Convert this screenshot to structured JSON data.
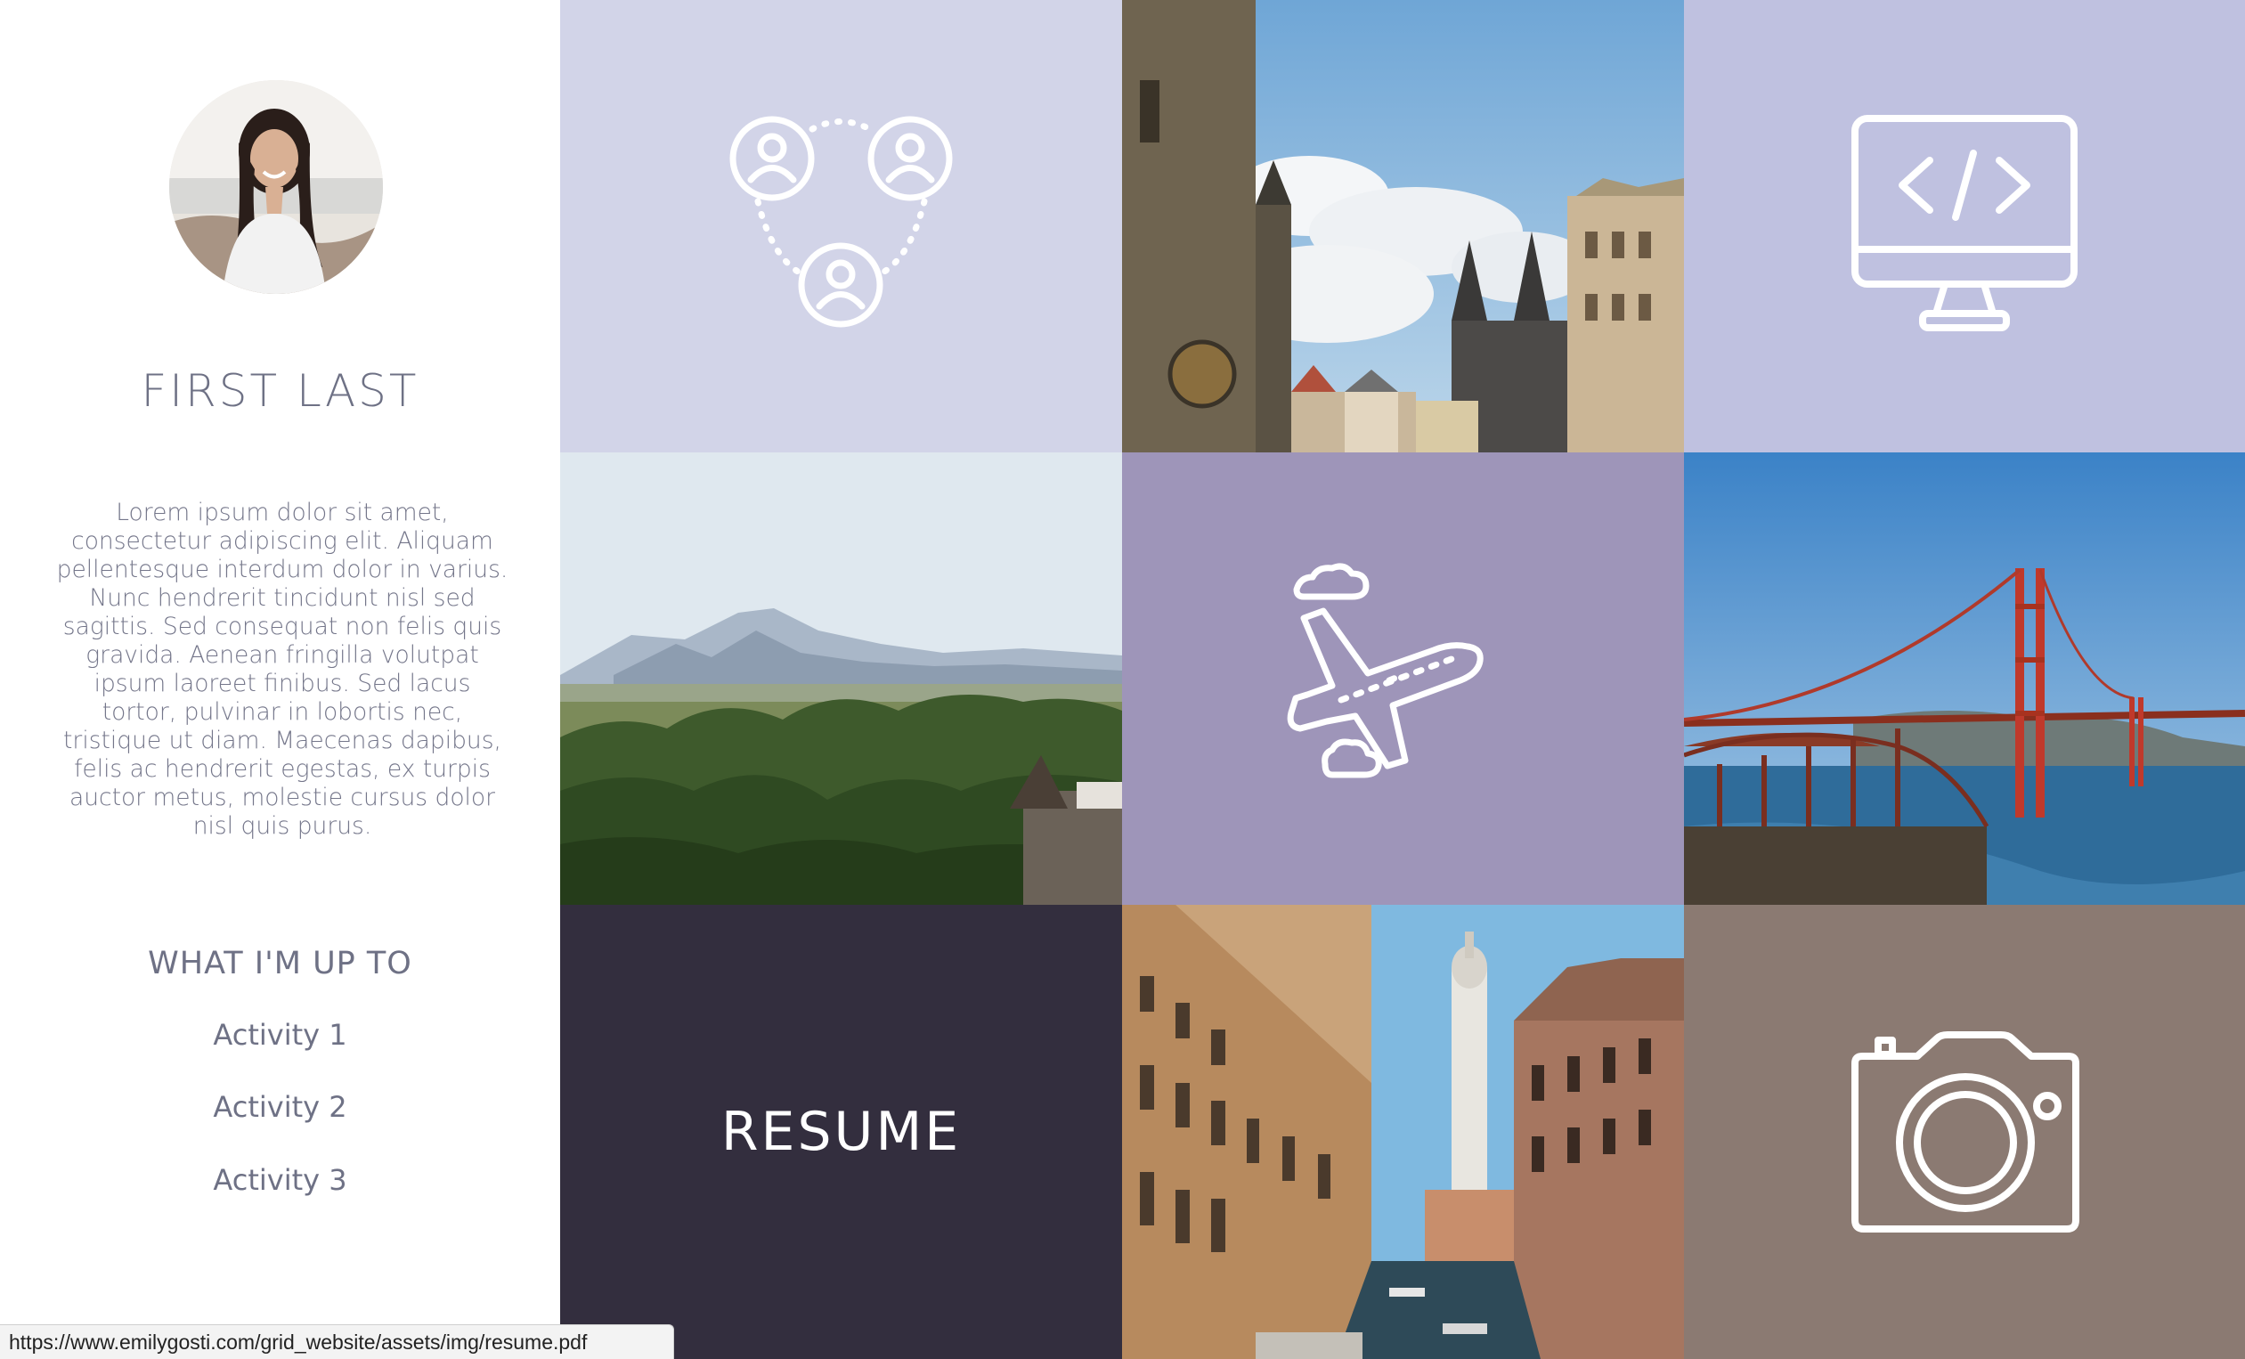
{
  "profile": {
    "name": "FIRST LAST",
    "bio": "Lorem ipsum dolor sit amet, consectetur adipiscing elit. Aliquam pellentesque interdum dolor in varius. Nunc hendrerit tincidunt nisl sed sagittis. Sed consequat non felis quis gravida. Aenean fringilla volutpat ipsum laoreet finibus. Sed lacus tortor, pulvinar in lobortis nec, tristique ut diam. Maecenas dapibus, felis ac hendrerit egestas, ex turpis auctor metus, molestie cursus dolor nisl quis purus."
  },
  "up_to": {
    "title": "WHAT I'M UP TO",
    "activities": [
      "Activity 1",
      "Activity 2",
      "Activity 3"
    ]
  },
  "tiles": [
    {
      "name": "network-tile",
      "icon": "people-network-icon",
      "color": "#d2d4e8"
    },
    {
      "name": "photo-prague-tile",
      "icon": "prague-old-town-photo"
    },
    {
      "name": "code-tile",
      "icon": "monitor-code-icon",
      "color": "#bfc1e0"
    },
    {
      "name": "photo-mountains-tile",
      "icon": "mountain-forest-photo"
    },
    {
      "name": "travel-tile",
      "icon": "airplane-icon",
      "color": "#9e95b9"
    },
    {
      "name": "photo-golden-gate-tile",
      "icon": "golden-gate-bridge-photo"
    },
    {
      "name": "resume-tile",
      "label": "RESUME",
      "color": "#332e3e"
    },
    {
      "name": "photo-venice-tile",
      "icon": "venice-canal-photo"
    },
    {
      "name": "photography-tile",
      "icon": "camera-icon",
      "color": "#8b7a72"
    }
  ],
  "status_bar": {
    "url": "https://www.emilygosti.com/grid_website/assets/img/resume.pdf"
  }
}
